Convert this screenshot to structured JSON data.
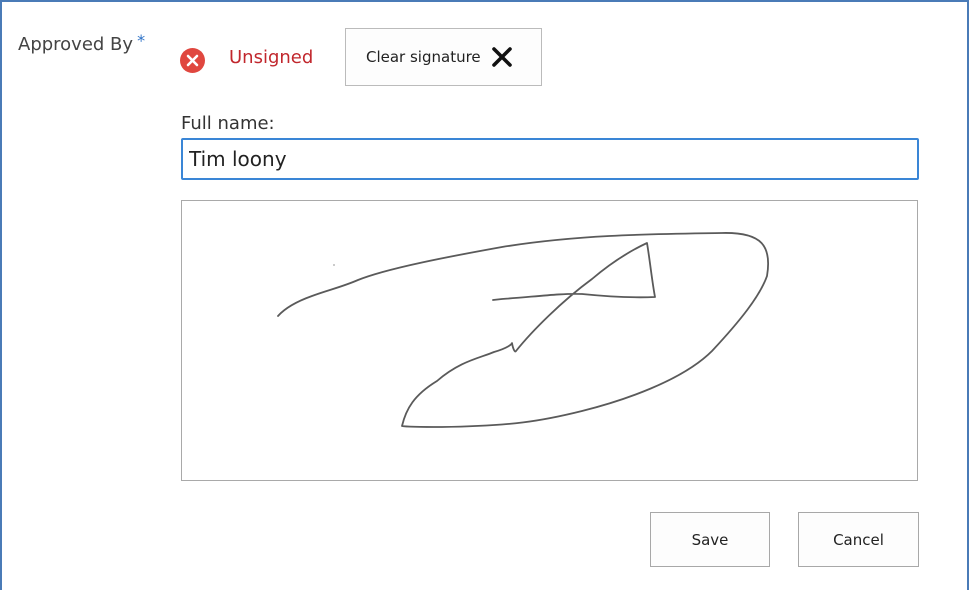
{
  "field": {
    "label": "Approved By",
    "required_marker": "*"
  },
  "signature_status": {
    "icon": "error-x-icon",
    "text": "Unsigned",
    "color": "#c1272d"
  },
  "clear_signature": {
    "label": "Clear signature",
    "icon": "close-x-icon"
  },
  "full_name": {
    "label": "Full name:",
    "value": "Tim loony"
  },
  "signature_pad": {
    "signed": true
  },
  "actions": {
    "save_label": "Save",
    "cancel_label": "Cancel"
  },
  "colors": {
    "accent": "#3a86d6",
    "required": "#2e72c7",
    "error_icon": "#e0473f",
    "frame": "#4a7bb7"
  }
}
